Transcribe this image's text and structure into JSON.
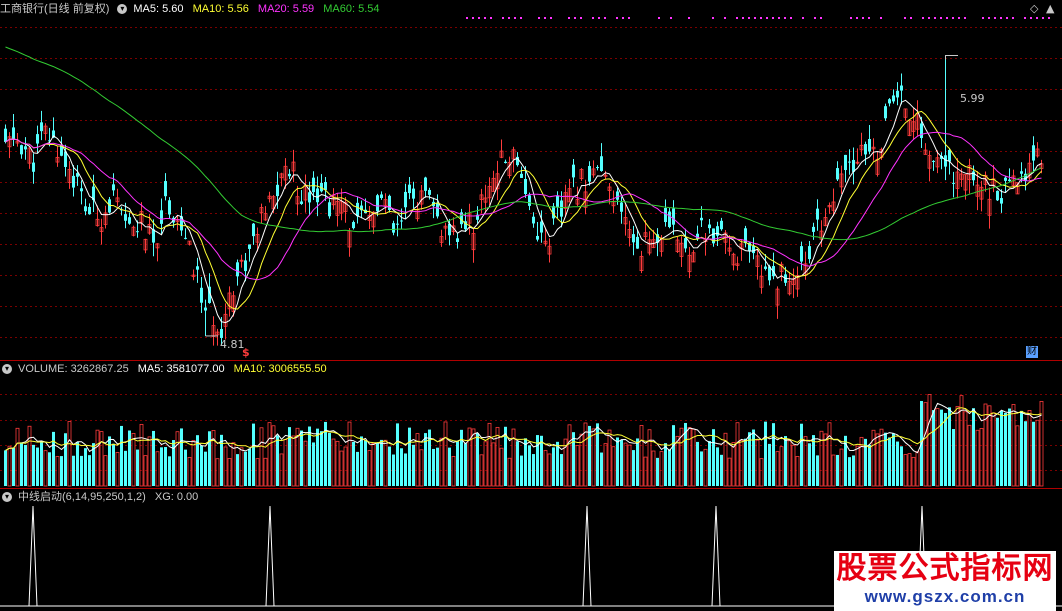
{
  "price_header": {
    "title": "工商银行(日线 前复权)",
    "ma5": "MA5: 5.60",
    "ma10": "MA10: 5.56",
    "ma20": "MA20: 5.59",
    "ma60": "MA60: 5.54"
  },
  "volume_header": {
    "volume": "VOLUME: 3262867.25",
    "ma5": "MA5: 3581077.00",
    "ma10": "MA10: 3006555.50"
  },
  "indicator_header": {
    "name": "中线启动(6,14,95,250,1,2)",
    "xg": "XG: 0.00"
  },
  "annotations": {
    "high": "5.99",
    "low": "4.81",
    "dollar_marker": "$",
    "finance_marker": "财"
  },
  "watermark": {
    "title": "股票公式指标网",
    "url": "www.gszx.com.cn"
  },
  "colors": {
    "up": "#ff3c3c",
    "down": "#54ffff",
    "ma5": "#ffffff",
    "ma10": "#ffff33",
    "ma20": "#ff33ff",
    "ma60": "#33cc33",
    "grid": "#7a0000"
  },
  "chart_data": {
    "type": "candlestick",
    "price_range": [
      4.75,
      6.15
    ],
    "marked_high": 5.99,
    "marked_low": 4.81,
    "ma_last": {
      "ma5": 5.6,
      "ma10": 5.56,
      "ma20": 5.59,
      "ma60": 5.54
    },
    "close_path": [
      5.62,
      5.65,
      5.55,
      5.68,
      5.6,
      5.5,
      5.35,
      5.32,
      5.4,
      5.25,
      5.3,
      5.2,
      5.4,
      5.28,
      5.1,
      4.9,
      4.85,
      5.05,
      5.15,
      5.3,
      5.4,
      5.55,
      5.42,
      5.45,
      5.38,
      5.35,
      5.28,
      5.3,
      5.4,
      5.22,
      5.38,
      5.4,
      5.32,
      5.2,
      5.28,
      5.3,
      5.48,
      5.55,
      5.6,
      5.35,
      5.2,
      5.3,
      5.42,
      5.48,
      5.52,
      5.4,
      5.3,
      5.2,
      5.22,
      5.25,
      5.23,
      5.2,
      5.26,
      5.22,
      5.18,
      5.15,
      5.1,
      5.08,
      5.05,
      5.1,
      5.2,
      5.35,
      5.45,
      5.55,
      5.58,
      5.62,
      5.82,
      5.8,
      5.68,
      5.55,
      5.52,
      5.48,
      5.5,
      5.45,
      5.4,
      5.45,
      5.55,
      5.6
    ],
    "volume_ma10_last": 3006555.5,
    "signal_spikes": [
      33,
      270,
      587,
      716,
      922
    ]
  }
}
